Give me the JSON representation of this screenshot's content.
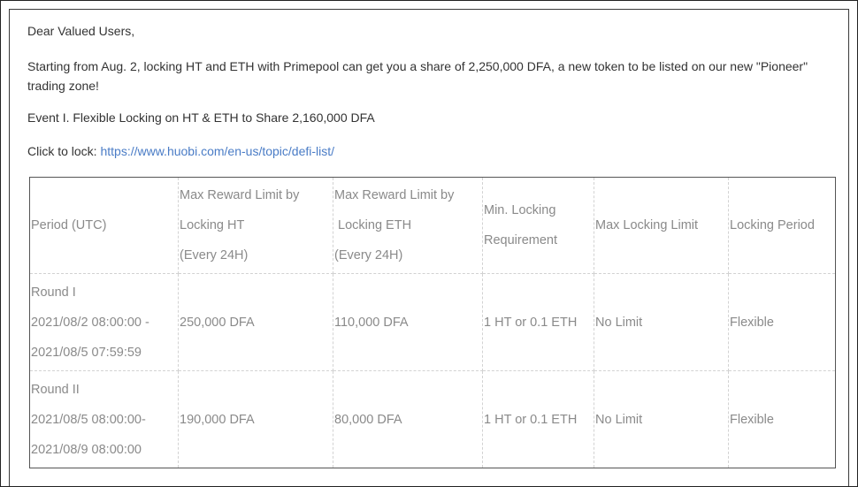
{
  "greeting": "Dear Valued Users,",
  "intro": "Starting from Aug. 2, locking HT and ETH with Primepool can get you a share of 2,250,000 DFA, a new token to be listed on our new \"Pioneer\" trading zone!",
  "event_title": "Event I. Flexible Locking on HT & ETH to Share 2,160,000 DFA",
  "lock_prefix": "Click to lock: ",
  "lock_url": "https://www.huobi.com/en-us/topic/defi-list/",
  "colors": {
    "link": "#4a7cc6",
    "body_text": "#333333",
    "table_text": "#8a8a8a"
  },
  "table": {
    "headers": {
      "period": "Period (UTC)",
      "max_ht": [
        "Max Reward Limit by",
        "Locking HT",
        "(Every 24H)"
      ],
      "max_eth": [
        "Max Reward Limit by",
        " Locking ETH",
        "(Every 24H)"
      ],
      "min_lock": [
        "Min. Locking",
        "Requirement"
      ],
      "max_lock": "Max Locking Limit",
      "lock_period": "Locking Period"
    },
    "rows": [
      {
        "period": [
          "Round I",
          "2021/08/2 08:00:00 -",
          "2021/08/5 07:59:59"
        ],
        "max_ht": "250,000 DFA",
        "max_eth": "110,000 DFA",
        "min_lock": "1 HT or 0.1 ETH",
        "max_lock": "No Limit",
        "lock_period": "Flexible"
      },
      {
        "period": [
          "Round II",
          "2021/08/5 08:00:00-",
          "2021/08/9 08:00:00"
        ],
        "max_ht": "190,000 DFA",
        "max_eth": "80,000 DFA",
        "min_lock": "1 HT or 0.1 ETH",
        "max_lock": "No Limit",
        "lock_period": "Flexible"
      }
    ]
  }
}
